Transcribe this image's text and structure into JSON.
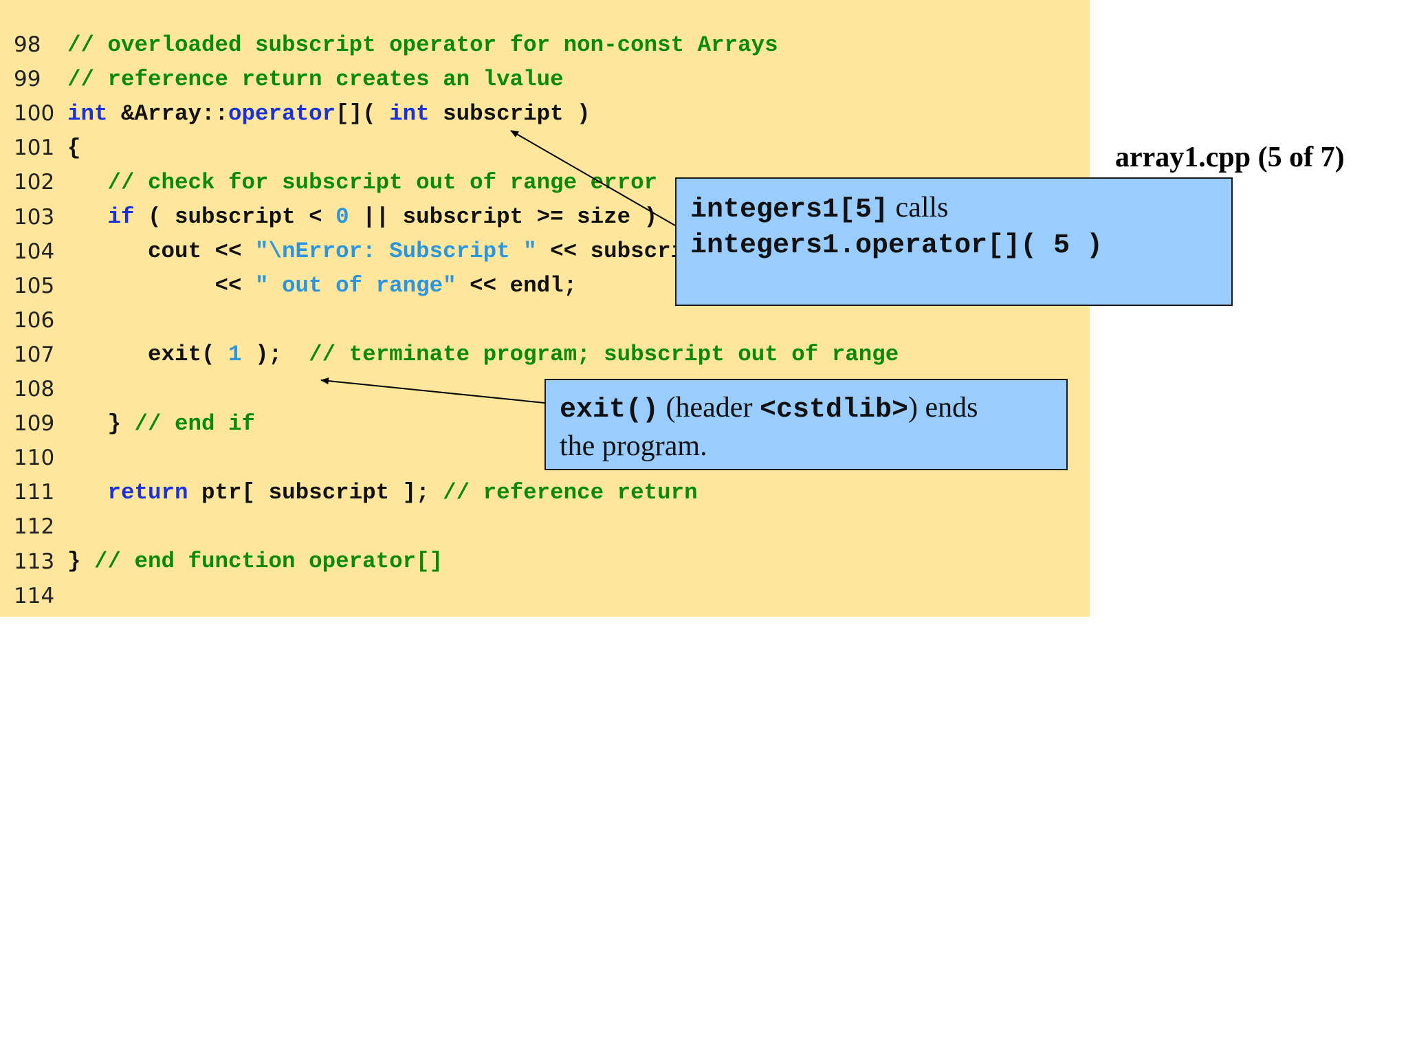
{
  "slide_title": "array1.cpp (5 of 7)",
  "colors": {
    "code_background": "#fee69c",
    "callout_background": "#99ccff",
    "comment": "#0a8a0a",
    "keyword": "#1a30d8",
    "literal": "#2a96e0",
    "plain": "#111111"
  },
  "code_lines": [
    {
      "num": "98",
      "tokens": [
        {
          "t": "com",
          "s": "// overloaded subscript operator for non-const Arrays"
        }
      ]
    },
    {
      "num": "99",
      "tokens": [
        {
          "t": "com",
          "s": "// reference return creates an lvalue"
        }
      ]
    },
    {
      "num": "100",
      "tokens": [
        {
          "t": "kw",
          "s": "int"
        },
        {
          "t": "plain",
          "s": " &Array::"
        },
        {
          "t": "kw",
          "s": "operator"
        },
        {
          "t": "plain",
          "s": "[]( "
        },
        {
          "t": "kw",
          "s": "int"
        },
        {
          "t": "plain",
          "s": " subscript )"
        }
      ]
    },
    {
      "num": "101",
      "tokens": [
        {
          "t": "plain",
          "s": "{"
        }
      ]
    },
    {
      "num": "102",
      "tokens": [
        {
          "t": "plain",
          "s": "   "
        },
        {
          "t": "com",
          "s": "// check for subscript out of range error"
        }
      ]
    },
    {
      "num": "103",
      "tokens": [
        {
          "t": "plain",
          "s": "   "
        },
        {
          "t": "kw",
          "s": "if"
        },
        {
          "t": "plain",
          "s": " ( subscript < "
        },
        {
          "t": "num",
          "s": "0"
        },
        {
          "t": "plain",
          "s": " || subscript >= size )"
        }
      ]
    },
    {
      "num": "104",
      "tokens": [
        {
          "t": "plain",
          "s": "      cout << "
        },
        {
          "t": "str",
          "s": "\"\\nError: Subscript \""
        },
        {
          "t": "plain",
          "s": " << subscript"
        }
      ]
    },
    {
      "num": "105",
      "tokens": [
        {
          "t": "plain",
          "s": "           << "
        },
        {
          "t": "str",
          "s": "\" out of range\""
        },
        {
          "t": "plain",
          "s": " << endl;"
        }
      ]
    },
    {
      "num": "106",
      "tokens": []
    },
    {
      "num": "107",
      "tokens": [
        {
          "t": "plain",
          "s": "      exit( "
        },
        {
          "t": "num",
          "s": "1"
        },
        {
          "t": "plain",
          "s": " );  "
        },
        {
          "t": "com",
          "s": "// terminate program; subscript out of range"
        }
      ]
    },
    {
      "num": "108",
      "tokens": []
    },
    {
      "num": "109",
      "tokens": [
        {
          "t": "plain",
          "s": "   } "
        },
        {
          "t": "com",
          "s": "// end if"
        }
      ]
    },
    {
      "num": "110",
      "tokens": []
    },
    {
      "num": "111",
      "tokens": [
        {
          "t": "plain",
          "s": "   "
        },
        {
          "t": "kw",
          "s": "return"
        },
        {
          "t": "plain",
          "s": " ptr[ subscript ]; "
        },
        {
          "t": "com",
          "s": "// reference return"
        }
      ]
    },
    {
      "num": "112",
      "tokens": []
    },
    {
      "num": "113",
      "tokens": [
        {
          "t": "plain",
          "s": "} "
        },
        {
          "t": "com",
          "s": "// end function operator[]"
        }
      ]
    },
    {
      "num": "114",
      "tokens": []
    }
  ],
  "callouts": {
    "operator": {
      "line1_code": "integers1[5]",
      "line1_text": " calls",
      "line2_code": "integers1.operator[]( 5 )"
    },
    "exit": {
      "code1": "exit()",
      "text1": " (header ",
      "code2": "<cstdlib>",
      "text2": ") ends",
      "line2_text": "the program."
    }
  }
}
